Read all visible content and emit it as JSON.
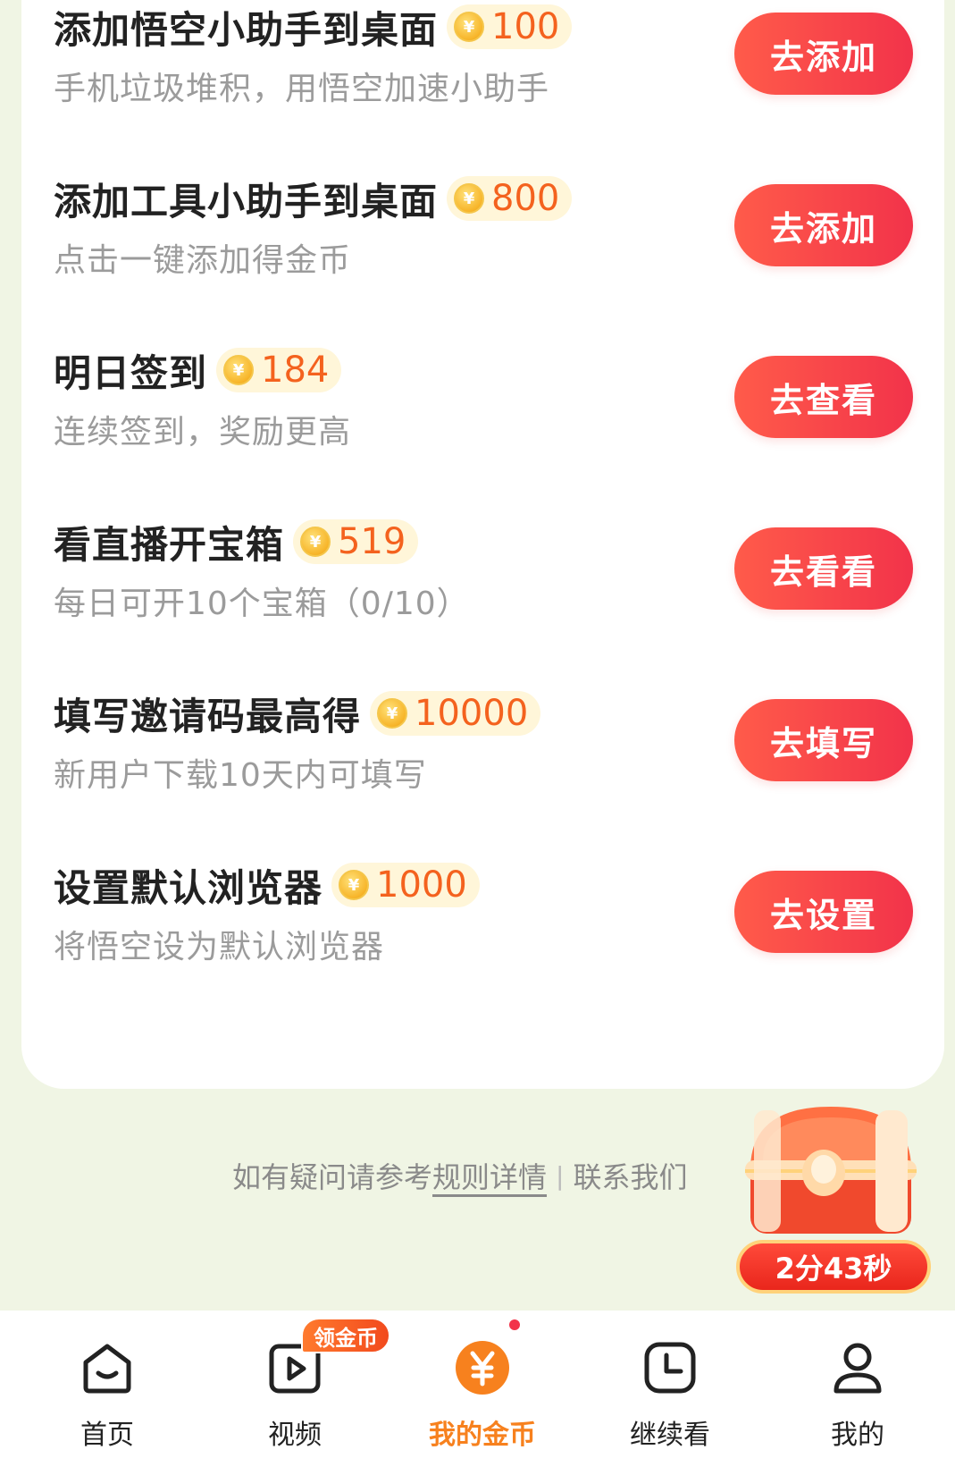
{
  "tasks": [
    {
      "title": "添加悟空小助手到桌面",
      "coins": "100",
      "desc": "手机垃圾堆积，用悟空加速小助手",
      "button": "去添加"
    },
    {
      "title": "添加工具小助手到桌面",
      "coins": "800",
      "desc": "点击一键添加得金币",
      "button": "去添加"
    },
    {
      "title": "明日签到",
      "coins": "184",
      "desc": "连续签到，奖励更高",
      "button": "去查看"
    },
    {
      "title": "看直播开宝箱",
      "coins": "519",
      "desc": "每日可开10个宝箱（0/10）",
      "button": "去看看"
    },
    {
      "title": "填写邀请码最高得",
      "coins": "10000",
      "desc": "新用户下载10天内可填写",
      "button": "去填写"
    },
    {
      "title": "设置默认浏览器",
      "coins": "1000",
      "desc": "将悟空设为默认浏览器",
      "button": "去设置"
    }
  ],
  "coin_symbol": "¥",
  "help": {
    "prefix": "如有疑问请参考",
    "rules_link": "规则详情",
    "separator": "|",
    "contact": "联系我们"
  },
  "chest": {
    "timer": "2分43秒"
  },
  "nav": {
    "items": [
      {
        "label": "首页",
        "icon": "home-icon"
      },
      {
        "label": "视频",
        "icon": "video-icon",
        "badge": "领金币"
      },
      {
        "label": "我的金币",
        "icon": "coin-icon",
        "active": true
      },
      {
        "label": "继续看",
        "icon": "clock-icon"
      },
      {
        "label": "我的",
        "icon": "user-icon"
      }
    ]
  },
  "colors": {
    "accent": "#f2334a",
    "coin_text": "#f4621e",
    "active_nav": "#f7811e",
    "page_bg": "#f0f5e4"
  }
}
